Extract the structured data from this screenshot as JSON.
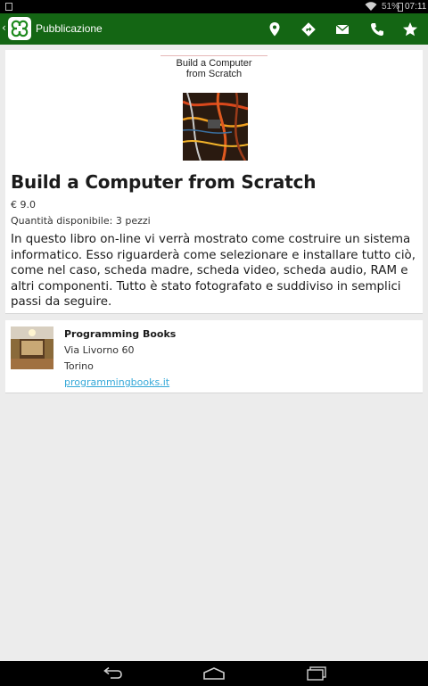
{
  "status_bar": {
    "battery_percent": "51%",
    "time": "07:11",
    "icons": [
      "notification-icon",
      "wifi-icon",
      "battery-icon"
    ]
  },
  "action_bar": {
    "title": "Pubblicazione",
    "background": "#146614",
    "icons": [
      "back-chevron-icon",
      "app-logo-icon",
      "map-pin-icon",
      "directions-icon",
      "mail-icon",
      "phone-icon",
      "star-icon"
    ]
  },
  "publication": {
    "cover": {
      "title_text": "Build a Computer\nfrom Scratch"
    },
    "title": "Build a Computer from Scratch",
    "price": "€ 9.0",
    "quantity": "Quantità disponibile: 3 pezzi",
    "description": "In questo libro on-line vi verrà mostrato come costruire un sistema informatico. Esso riguarderà come selezionare e installare tutto ciò, come nel caso, scheda madre, scheda video, scheda audio, RAM e altri componenti. Tutto è stato fotografato e suddiviso in semplici passi da seguire."
  },
  "store": {
    "name": "Programming Books",
    "street": "Via Livorno 60",
    "city": "Torino",
    "website": "programmingbooks.it",
    "link_color": "#34a8d8"
  },
  "nav_bar": {
    "icons": [
      "back-icon",
      "home-icon",
      "recent-apps-icon"
    ]
  }
}
